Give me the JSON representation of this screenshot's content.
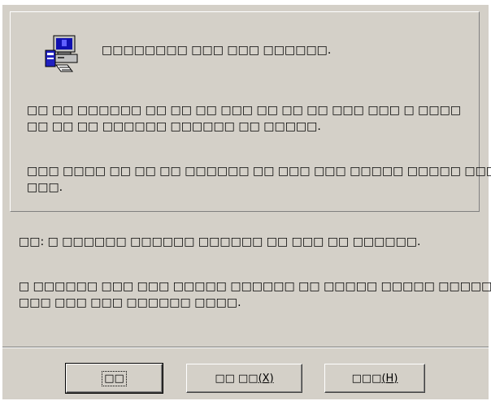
{
  "dialog": {
    "heading": "□□□□□□□□ □□□ □□□ □□□□□□.",
    "info_lines": [
      "□□ □□ □□□□□□ □□  □□ □□ □□□ □□ □□ □□ □□□ □□□ □ □□□□",
      "□□ □□ □□ □□□□□□ □□□□□□ □□ □□□□□.",
      "□□□ □□□□ □□ □□ □□ □□□□□□ □□ □□□ □□□ □□□□□ □□□□□ □□□",
      "□□□."
    ],
    "note_lines": [
      "□□: □ □□□□□□ □□□□□□ □□□□□□ □□ □□□ □□ □□□□□□.",
      "□ □□□□□□ □□□ □□□ □□□□□ □□□□□□ □□ □□□□□ □□□□□ □□□□□ □",
      "□□□ □□□ □□□ □□□□□□ □□□□."
    ]
  },
  "buttons": {
    "ok_label": "□□",
    "cancel_label": "□□ □□",
    "cancel_mnemonic": "(X)",
    "help_label": "□□□",
    "help_mnemonic": "(H)"
  },
  "icons": {
    "app": "computer-install-icon"
  },
  "colors": {
    "dialog_face": "#d4d0c8",
    "shadow": "#808080",
    "highlight": "#ffffff",
    "icon_blue": "#2020c0"
  }
}
